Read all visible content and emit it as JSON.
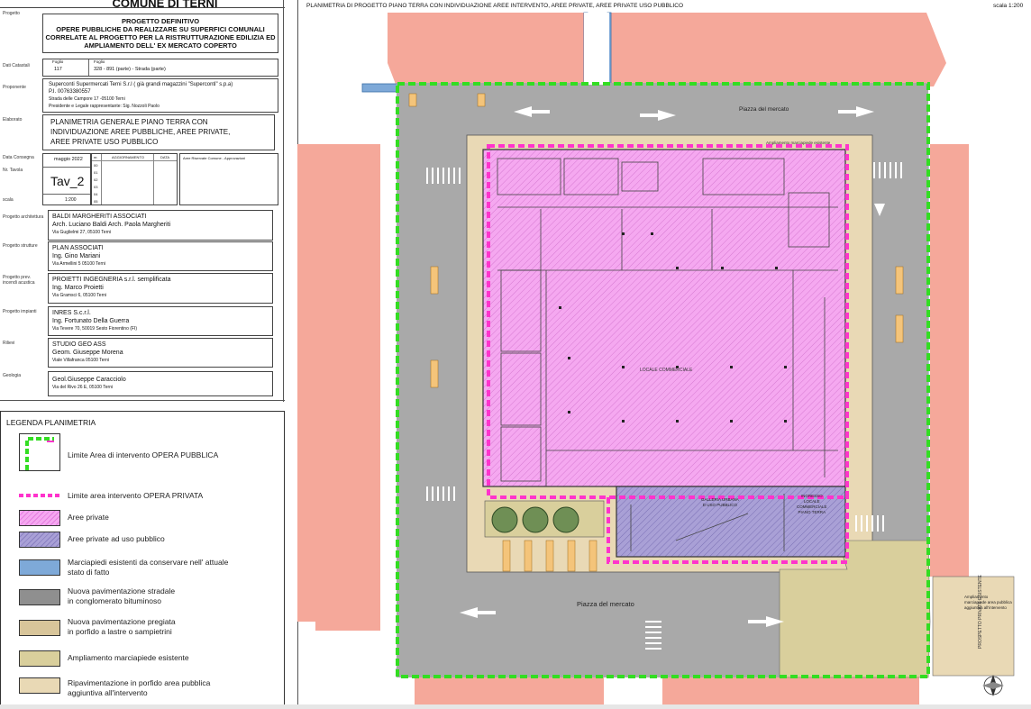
{
  "titleblock": {
    "comune": "COMUNE DI TERNI",
    "rows": {
      "progetto": {
        "label": "Progetto",
        "lines": [
          "PROGETTO DEFINITIVO",
          "OPERE PUBBLICHE  DA REALIZZARE SU SUPERFICI COMUNALI",
          "CORRELATE AL PROGETTO PER LA RISTRUTTURAZIONE EDILIZIA ED",
          "AMPLIAMENTO DELL' EX MERCATO COPERTO"
        ]
      },
      "dati_catastali": {
        "label": "Dati Catastali",
        "foglio_label": "Foglio",
        "foglio": "117",
        "foglio_ext_label": "Foglio",
        "particelle": "328 - 891 (parte) - Strada (parte)"
      },
      "proponente": {
        "label": "Proponente",
        "lines": [
          "Superconti Supermercati Terni S.r.l ( già grandi magazzini \"Superconti\" s.p.a)",
          "P.I. 00763380557",
          "Strada delle Campore 17 -05100 Terni",
          "Presidente e Legale rappresentante: Sig. Nozzoli Paolo"
        ]
      },
      "elaborato": {
        "label": "Elaborato",
        "lines": [
          "PLANIMETRIA GENERALE PIANO TERRA CON",
          "INDIVIDUAZIONE AREE PUBBLICHE, AREE PRIVATE,",
          "AREE PRIVATE USO PUBBLICO"
        ]
      },
      "data_consegna": {
        "label": "Data Consegna",
        "value": "maggio  2022"
      },
      "tavola": {
        "label": "Nr. Tavola",
        "value": "Tav_2"
      },
      "scala": {
        "label": "scala",
        "value": "1:200"
      },
      "rev_headers": [
        "nr.",
        "AGGIORNAMENTO",
        "DATA"
      ],
      "rev_numbers": [
        "00",
        "01",
        "02",
        "03",
        "04",
        "05"
      ],
      "rev_note": "Aree Riservate Comune - Approvazioni",
      "architettura": {
        "label": "Progetto architettura",
        "lines": [
          "BALDI MARGHERITI ASSOCIATI",
          "Arch. Luciano Baldi Arch. Paola Margheriti",
          "Via Guglielmi 27, 05100  Terni"
        ]
      },
      "strutture": {
        "label": "Progetto strutture",
        "lines": [
          "PLAN ASSOCIATI",
          "Ing. Gino Mariani",
          "Via Armellini 5  05100  Terni"
        ]
      },
      "antincendio": {
        "label": "Progetto prev. incendi acustica",
        "lines": [
          "PROIETTI INGEGNERIA s.r.l. semplificata",
          "Ing. Marco Proietti",
          "Via Gramsci 6, 05100  Terni"
        ]
      },
      "impianti": {
        "label": "Progetto impianti",
        "lines": [
          "INRES  S.c.r.l.",
          "Ing. Fortunato Della Guerra",
          "Via Tevere 70, 50019 Sesto Fiorentino (FI)"
        ]
      },
      "rilievi": {
        "label": "Rilievi",
        "lines": [
          "STUDIO GEO ASS",
          "Geom. Giuseppe Morena",
          "Viale Villafranca  05100  Terni"
        ]
      },
      "geologia": {
        "label": "Geologia",
        "lines": [
          "Geol.Giuseppe Caracciolo",
          "Via del Rivo 26 E, 05100  Terni"
        ]
      }
    }
  },
  "legend": {
    "title": "LEGENDA PLANIMETRIA",
    "items": [
      {
        "text": [
          "Limite Area di intervento OPERA PUBBLICA"
        ]
      },
      {
        "text": [
          "Limite area intervento OPERA PRIVATA"
        ]
      },
      {
        "text": [
          "Aree private"
        ]
      },
      {
        "text": [
          "Aree private ad uso pubblico"
        ]
      },
      {
        "text": [
          "Marciapiedi esistenti da conservare nell' attuale",
          "stato di fatto"
        ]
      },
      {
        "text": [
          "Nuova pavimentazione stradale",
          "in conglomerato bituminoso"
        ]
      },
      {
        "text": [
          "Nuova pavimentazione pregiata",
          "in porfido a lastre o sampietrini"
        ]
      },
      {
        "text": [
          "Ampliamento marciapiede esistente"
        ]
      },
      {
        "text": [
          "Ripavimentazione in porfido area pubblica",
          "aggiuntiva all'intervento"
        ]
      }
    ]
  },
  "plan": {
    "title": "PLANIMETRIA DI PROGETTO PIANO TERRA CON  INDIVIDUAZIONE AREE INTERVENTO, AREE PRIVATE, AREE PRIVATE USO PUBBLICO",
    "scale": "scala 1:200",
    "street_north": "Piazza del mercato",
    "street_south": "Piazza del mercato",
    "locale": "LOCALE COMMERCIALE",
    "galleria": [
      "GALLERIA URBANA",
      "D USO PUBBLICO"
    ],
    "ingresso": [
      "INGRESSO",
      "LOCALE",
      "COMMERCIALE",
      "PIANO TERRA"
    ],
    "north_label": "",
    "side_note": "PROSPETTO PRIVATE ESISTENTE",
    "annot_right": [
      "Ampliamento",
      "marciapiede area pubblica",
      "aggiuntiva all'intervento"
    ],
    "top_note": "Ampliamento marciapiede esistente"
  },
  "colors": {
    "green_limit": "#33dd22",
    "magenta_limit": "#ff33cc",
    "private": "#f5a8f0",
    "private_public": "#a9a0d6",
    "sidewalk": "#7ea9d8",
    "asphalt": "#a5a5a5",
    "porphyry": "#e9d9b5",
    "ext_sidewalk": "#c9b585",
    "neighbors": "#f5a89a"
  }
}
